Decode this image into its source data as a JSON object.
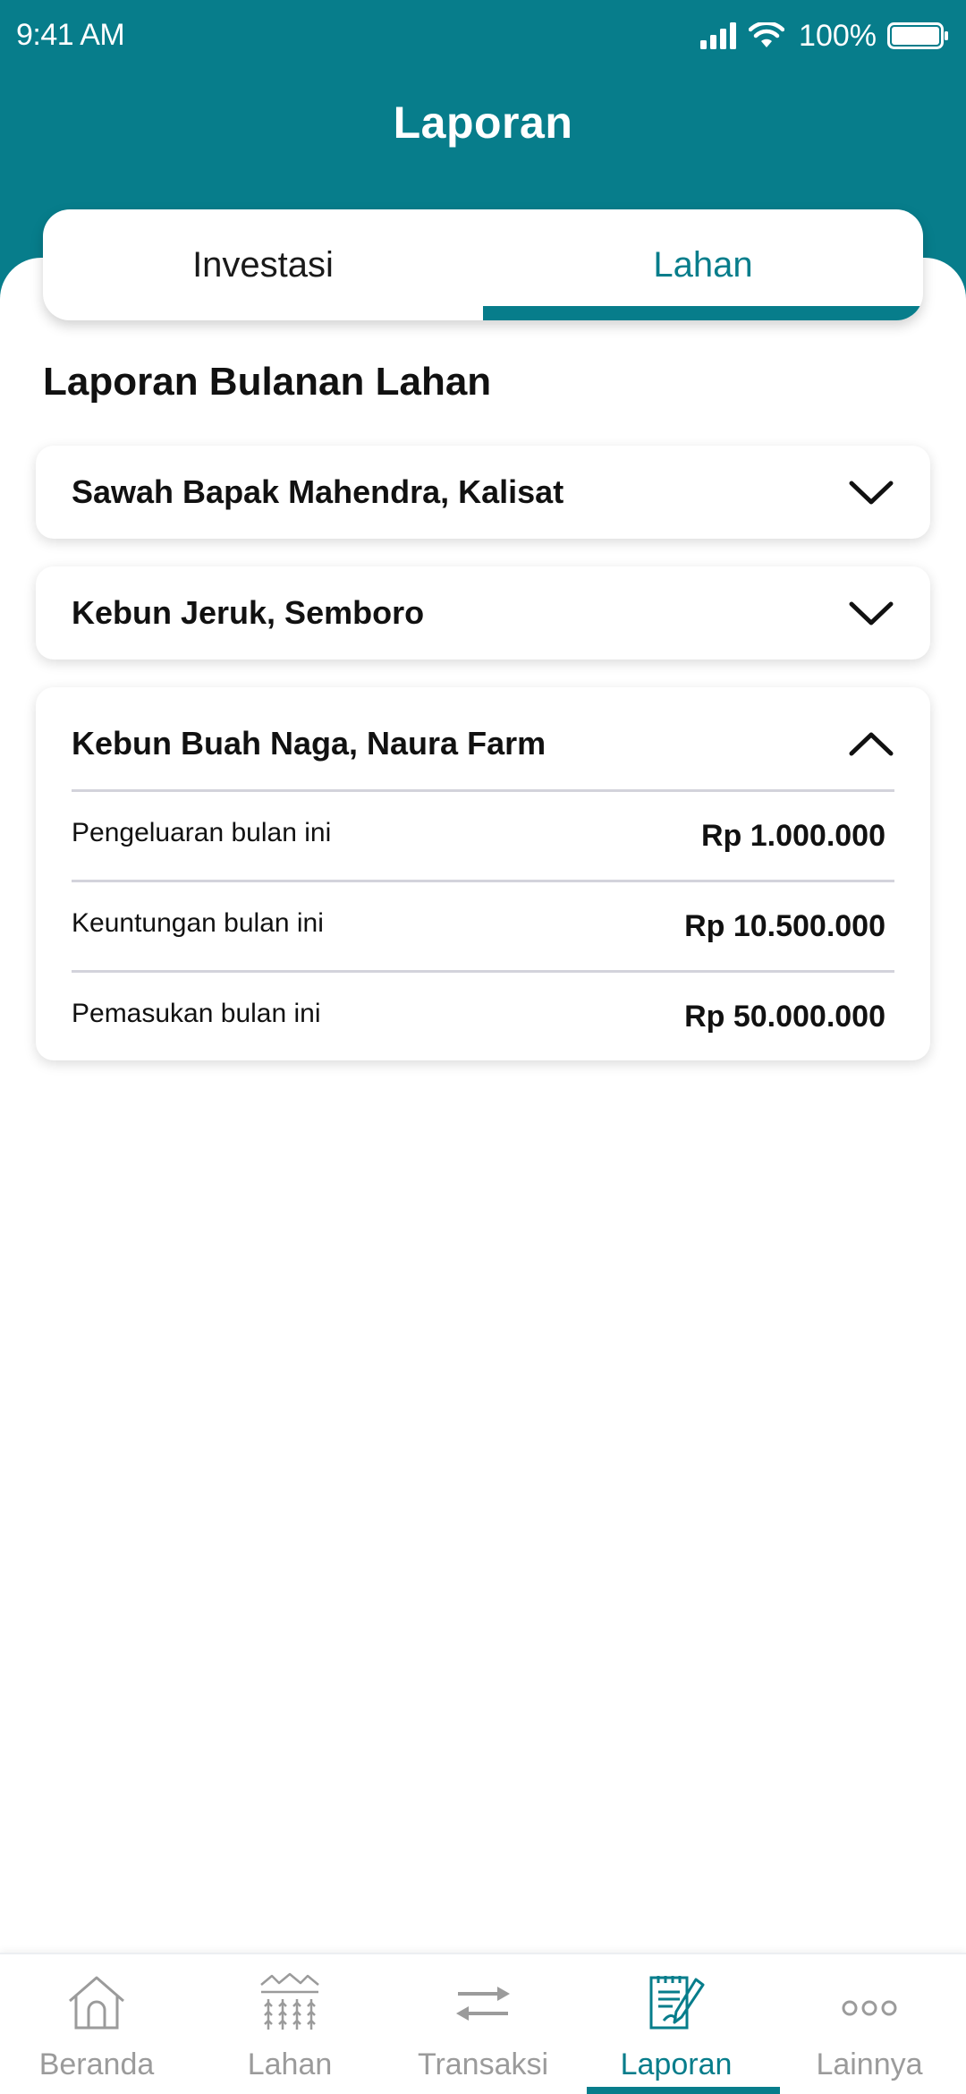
{
  "status_bar": {
    "time": "9:41 AM",
    "battery": "100%",
    "icons": [
      "signal-icon",
      "wifi-icon",
      "battery-icon"
    ]
  },
  "header": {
    "title": "Laporan"
  },
  "tabs": [
    {
      "label": "Investasi",
      "active": false
    },
    {
      "label": "Lahan",
      "active": true
    }
  ],
  "section": {
    "title": "Laporan Bulanan Lahan"
  },
  "cards": [
    {
      "title": "Sawah Bapak Mahendra, Kalisat",
      "expanded": false,
      "icon": "chevron-down-icon"
    },
    {
      "title": "Kebun Jeruk, Semboro",
      "expanded": false,
      "icon": "chevron-down-icon"
    },
    {
      "title": "Kebun Buah Naga, Naura Farm",
      "expanded": true,
      "icon": "chevron-up-icon",
      "rows": [
        {
          "label": "Pengeluaran bulan ini",
          "value": "Rp 1.000.000"
        },
        {
          "label": "Keuntungan bulan ini",
          "value": "Rp 10.500.000"
        },
        {
          "label": "Pemasukan bulan ini",
          "value": "Rp 50.000.000"
        }
      ]
    }
  ],
  "bottom_nav": [
    {
      "label": "Beranda",
      "icon": "home-icon",
      "active": false
    },
    {
      "label": "Lahan",
      "icon": "field-icon",
      "active": false
    },
    {
      "label": "Transaksi",
      "icon": "transfer-icon",
      "active": false
    },
    {
      "label": "Laporan",
      "icon": "report-icon",
      "active": true
    },
    {
      "label": "Lainnya",
      "icon": "more-icon",
      "active": false
    }
  ],
  "colors": {
    "primary": "#077d8b",
    "text": "#111111",
    "inactive_nav": "#9b9b9b",
    "divider": "#d3d3db"
  }
}
